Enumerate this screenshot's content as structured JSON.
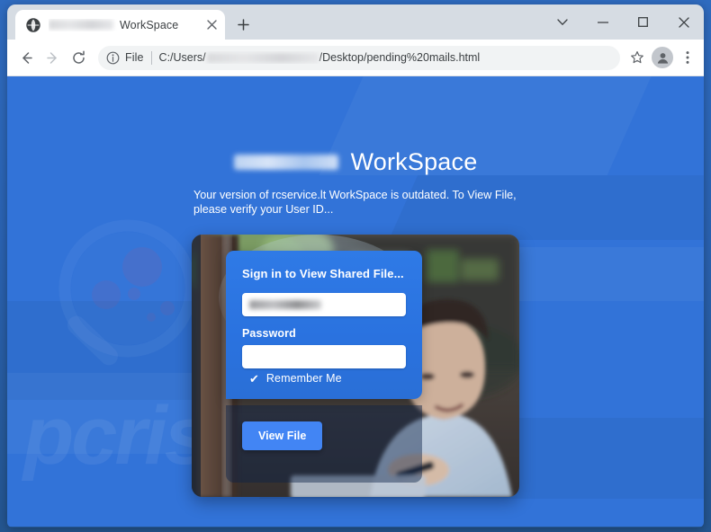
{
  "browser": {
    "tab": {
      "favicon": "globe-icon",
      "redacted_prefix": "",
      "title": "WorkSpace",
      "close_label": "×"
    },
    "new_tab_label": "+",
    "window_controls": {
      "expand_label": "⌄",
      "minimize_label": "–",
      "maximize_label": "□",
      "close_label": "×"
    },
    "toolbar": {
      "back_label": "←",
      "forward_label": "→",
      "reload_label": "⟳",
      "bookmark_label": "☆",
      "profile_label": "",
      "menu_label": "⋮"
    },
    "omnibox": {
      "info_icon": "info-circle-icon",
      "scheme_label": "File",
      "url_prefix": "C:/Users/",
      "url_suffix": "/Desktop/pending%20mails.html"
    }
  },
  "page": {
    "brand_name": "WorkSpace",
    "notice": "Your version of rcservice.lt WorkSpace is outdated. To View File, please verify your User ID...",
    "form": {
      "title": "Sign in to View Shared File...",
      "email_value": "",
      "password_label": "Password",
      "password_value": "",
      "remember_checkmark": "✔",
      "remember_label": "Remember Me",
      "submit_label": "View File"
    },
    "watermark_text": "pcrisk.com"
  },
  "colors": {
    "page_background": "#3273d8",
    "panel_blue": "#2f7ae6",
    "button_blue": "#4285f4",
    "frame_blue": "#2a62b1"
  }
}
